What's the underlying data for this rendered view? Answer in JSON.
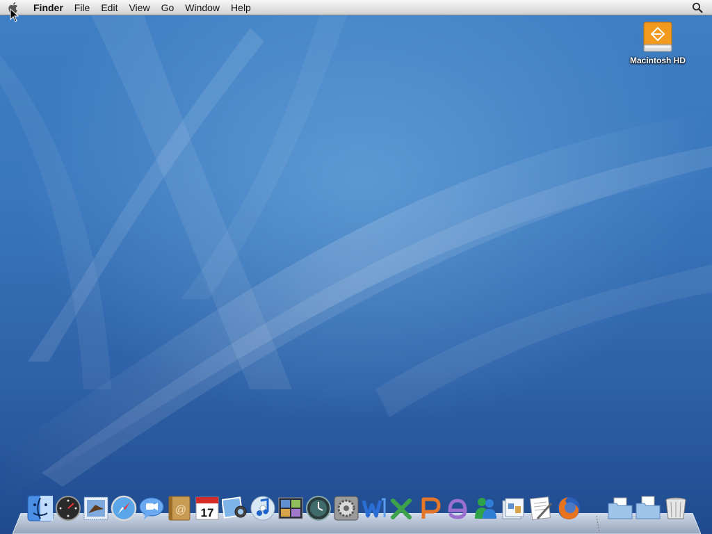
{
  "menubar": {
    "app_name": "Finder",
    "items": [
      "File",
      "Edit",
      "View",
      "Go",
      "Window",
      "Help"
    ]
  },
  "desktop": {
    "icons": [
      {
        "label": "Macintosh HD",
        "icon": "external-drive-icon"
      }
    ]
  },
  "dock": {
    "items": [
      {
        "name": "finder",
        "icon": "finder-icon"
      },
      {
        "name": "dashboard",
        "icon": "dashboard-icon"
      },
      {
        "name": "mail",
        "icon": "mail-icon"
      },
      {
        "name": "safari",
        "icon": "safari-icon"
      },
      {
        "name": "ichat",
        "icon": "ichat-icon"
      },
      {
        "name": "address-book",
        "icon": "address-book-icon",
        "glyph": "@"
      },
      {
        "name": "ical",
        "icon": "calendar-icon",
        "date": "17"
      },
      {
        "name": "iphoto",
        "icon": "iphoto-icon"
      },
      {
        "name": "itunes",
        "icon": "itunes-icon"
      },
      {
        "name": "spaces",
        "icon": "spaces-icon"
      },
      {
        "name": "time-machine",
        "icon": "time-machine-icon"
      },
      {
        "name": "system-preferences",
        "icon": "system-preferences-icon"
      },
      {
        "name": "word",
        "icon": "word-icon"
      },
      {
        "name": "excel",
        "icon": "excel-icon"
      },
      {
        "name": "powerpoint",
        "icon": "powerpoint-icon"
      },
      {
        "name": "entourage",
        "icon": "entourage-icon"
      },
      {
        "name": "messenger",
        "icon": "messenger-icon"
      },
      {
        "name": "applications-stack",
        "icon": "applications-stack-icon"
      },
      {
        "name": "textedit",
        "icon": "textedit-icon"
      },
      {
        "name": "firefox",
        "icon": "firefox-icon"
      },
      {
        "name": "documents-stack",
        "icon": "documents-folder-icon"
      },
      {
        "name": "downloads-stack",
        "icon": "downloads-folder-icon"
      },
      {
        "name": "trash",
        "icon": "trash-icon"
      }
    ]
  },
  "colors": {
    "desktop_blue": "#3a77bd",
    "drive_orange": "#f29a1e"
  }
}
